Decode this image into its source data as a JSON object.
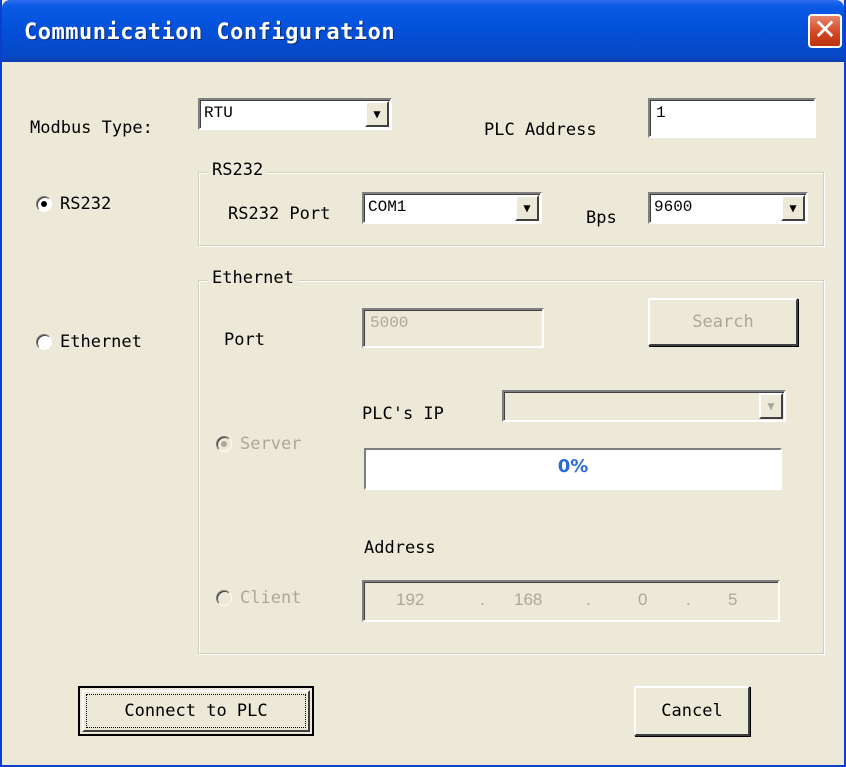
{
  "window": {
    "title": "Communication Configuration",
    "close_glyph": "✕"
  },
  "modbus": {
    "label": "Modbus Type:",
    "selected": "RTU"
  },
  "plc_address": {
    "label": "PLC Address",
    "value": "1"
  },
  "mode": {
    "rs232_label": "RS232",
    "ethernet_label": "Ethernet",
    "selected": "RS232"
  },
  "rs232_group": {
    "caption": "RS232",
    "port_label": "RS232 Port",
    "port_selected": "COM1",
    "bps_label": "Bps",
    "bps_selected": "9600"
  },
  "ethernet_group": {
    "caption": "Ethernet",
    "port_label": "Port",
    "port_value": "5000",
    "search_label": "Search",
    "plc_ip_label": "PLC's IP",
    "plc_ip_selected": "",
    "server_label": "Server",
    "client_label": "Client",
    "selected": "Server",
    "progress": {
      "percent": 0,
      "text": "0%"
    },
    "address_label": "Address",
    "ip_octets": [
      "192",
      "168",
      "0",
      "5"
    ],
    "ip_separator": "."
  },
  "buttons": {
    "connect": "Connect to PLC",
    "cancel": "Cancel"
  },
  "colors": {
    "titlebar": "#0350d8",
    "dialog_bg": "#ece9d8",
    "close": "#d0441e",
    "progress_text": "#2a6ad8"
  }
}
